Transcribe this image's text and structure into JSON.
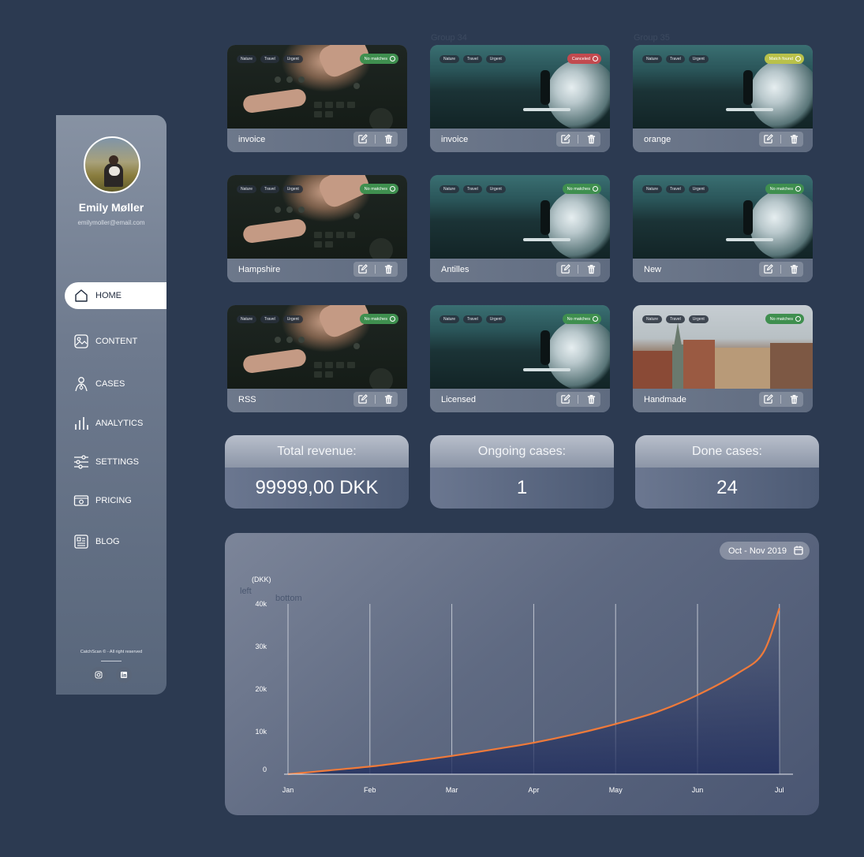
{
  "user": {
    "name": "Emily Møller",
    "email": "emilymoller@email.com"
  },
  "nav": {
    "items": [
      {
        "label": "HOME",
        "icon": "home-icon",
        "active": true
      },
      {
        "label": "CONTENT",
        "icon": "image-icon",
        "active": false
      },
      {
        "label": "CASES",
        "icon": "person-icon",
        "active": false
      },
      {
        "label": "ANALYTICS",
        "icon": "bar-chart-icon",
        "active": false
      },
      {
        "label": "SETTINGS",
        "icon": "sliders-icon",
        "active": false
      },
      {
        "label": "PRICING",
        "icon": "money-icon",
        "active": false
      },
      {
        "label": "BLOG",
        "icon": "newspaper-icon",
        "active": false
      }
    ]
  },
  "footer": {
    "copyright": "CatchScan © - All right reserved",
    "social": [
      "instagram-icon",
      "linkedin-icon"
    ]
  },
  "groups": [
    "Group 34",
    "Group 35"
  ],
  "cards": [
    {
      "title": "invoice",
      "image": "dj",
      "tags": [
        "Nature",
        "Travel",
        "Urgent"
      ],
      "status": "No matches",
      "status_type": "none"
    },
    {
      "title": "invoice",
      "image": "surf",
      "tags": [
        "Nature",
        "Travel",
        "Urgent"
      ],
      "status": "Canceled",
      "status_type": "canceled"
    },
    {
      "title": "orange",
      "image": "surf",
      "tags": [
        "Nature",
        "Travel",
        "Urgent"
      ],
      "status": "Match found",
      "status_type": "found"
    },
    {
      "title": "Hampshire",
      "image": "dj",
      "tags": [
        "Nature",
        "Travel",
        "Urgent"
      ],
      "status": "No matches",
      "status_type": "none"
    },
    {
      "title": "Antilles",
      "image": "surf",
      "tags": [
        "Nature",
        "Travel",
        "Urgent"
      ],
      "status": "No matches",
      "status_type": "none"
    },
    {
      "title": "New",
      "image": "surf",
      "tags": [
        "Nature",
        "Travel",
        "Urgent"
      ],
      "status": "No matches",
      "status_type": "none"
    },
    {
      "title": "RSS",
      "image": "dj",
      "tags": [
        "Nature",
        "Travel",
        "Urgent"
      ],
      "status": "No matches",
      "status_type": "none"
    },
    {
      "title": "Licensed",
      "image": "surf",
      "tags": [
        "Nature",
        "Travel",
        "Urgent"
      ],
      "status": "No matches",
      "status_type": "none"
    },
    {
      "title": "Handmade",
      "image": "city",
      "tags": [
        "Nature",
        "Travel",
        "Urgent"
      ],
      "status": "No matches",
      "status_type": "none"
    }
  ],
  "status_colors": {
    "none": "#3f8f4f",
    "canceled": "#c24a4f",
    "found": "#b9c14a"
  },
  "stats": [
    {
      "label": "Total revenue:",
      "value": "99999,00 DKK"
    },
    {
      "label": "Ongoing cases:",
      "value": "1"
    },
    {
      "label": "Done cases:",
      "value": "24"
    }
  ],
  "chart": {
    "date_range": "Oct - Nov 2019",
    "ghost_left": "left",
    "ghost_bottom": "bottom"
  },
  "chart_data": {
    "type": "line",
    "ylabel": "(DKK)",
    "categories": [
      "Jan",
      "Feb",
      "Mar",
      "Apr",
      "May",
      "Jun",
      "Jul"
    ],
    "yticks": [
      "0",
      "10k",
      "20k",
      "30k",
      "40k"
    ],
    "ylim": [
      0,
      40000
    ],
    "x": [
      0,
      0.5,
      1,
      1.5,
      2,
      2.5,
      3,
      3.5,
      4,
      4.5,
      5,
      5.5,
      5.8,
      6
    ],
    "values": [
      0,
      900,
      1800,
      3000,
      4300,
      5800,
      7400,
      9400,
      11800,
      14600,
      18600,
      23800,
      28500,
      39000
    ],
    "line_color": "#f07a3a",
    "grid": "vertical"
  }
}
